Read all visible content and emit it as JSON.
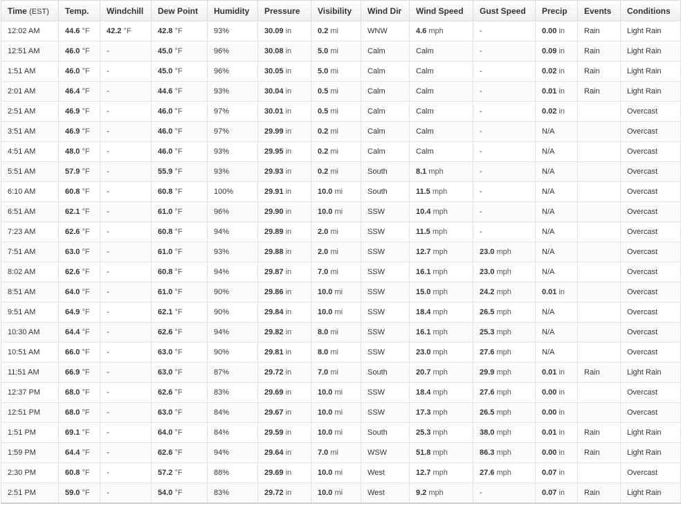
{
  "headers": {
    "time": "Time",
    "time_unit": "(EST)",
    "temp": "Temp.",
    "windchill": "Windchill",
    "dewpoint": "Dew Point",
    "humidity": "Humidity",
    "pressure": "Pressure",
    "visibility": "Visibility",
    "wind_dir": "Wind Dir",
    "wind_speed": "Wind Speed",
    "gust_speed": "Gust Speed",
    "precip": "Precip",
    "events": "Events",
    "conditions": "Conditions"
  },
  "units": {
    "temp": "°F",
    "pressure": "in",
    "visibility": "mi",
    "speed": "mph",
    "precip": "in"
  },
  "placeholders": {
    "dash": "-",
    "calm": "Calm",
    "na": "N/A"
  },
  "rows": [
    {
      "time": "12:02 AM",
      "temp": "44.6",
      "windchill": "42.2",
      "dewpoint": "42.8",
      "humidity": "93%",
      "pressure": "30.09",
      "visibility": "0.2",
      "wind_dir": "WNW",
      "wind_speed": "4.6",
      "gust": "-",
      "precip": "0.00",
      "events": "Rain",
      "conditions": "Light Rain"
    },
    {
      "time": "12:51 AM",
      "temp": "46.0",
      "windchill": "-",
      "dewpoint": "45.0",
      "humidity": "96%",
      "pressure": "30.08",
      "visibility": "5.0",
      "wind_dir": "Calm",
      "wind_speed": "Calm",
      "gust": "-",
      "precip": "0.09",
      "events": "Rain",
      "conditions": "Light Rain"
    },
    {
      "time": "1:51 AM",
      "temp": "46.0",
      "windchill": "-",
      "dewpoint": "45.0",
      "humidity": "96%",
      "pressure": "30.05",
      "visibility": "5.0",
      "wind_dir": "Calm",
      "wind_speed": "Calm",
      "gust": "-",
      "precip": "0.02",
      "events": "Rain",
      "conditions": "Light Rain"
    },
    {
      "time": "2:01 AM",
      "temp": "46.4",
      "windchill": "-",
      "dewpoint": "44.6",
      "humidity": "93%",
      "pressure": "30.04",
      "visibility": "0.5",
      "wind_dir": "Calm",
      "wind_speed": "Calm",
      "gust": "-",
      "precip": "0.01",
      "events": "Rain",
      "conditions": "Light Rain"
    },
    {
      "time": "2:51 AM",
      "temp": "46.9",
      "windchill": "-",
      "dewpoint": "46.0",
      "humidity": "97%",
      "pressure": "30.01",
      "visibility": "0.5",
      "wind_dir": "Calm",
      "wind_speed": "Calm",
      "gust": "-",
      "precip": "0.02",
      "events": "",
      "conditions": "Overcast"
    },
    {
      "time": "3:51 AM",
      "temp": "46.9",
      "windchill": "-",
      "dewpoint": "46.0",
      "humidity": "97%",
      "pressure": "29.99",
      "visibility": "0.2",
      "wind_dir": "Calm",
      "wind_speed": "Calm",
      "gust": "-",
      "precip": "N/A",
      "events": "",
      "conditions": "Overcast"
    },
    {
      "time": "4:51 AM",
      "temp": "48.0",
      "windchill": "-",
      "dewpoint": "46.0",
      "humidity": "93%",
      "pressure": "29.95",
      "visibility": "0.2",
      "wind_dir": "Calm",
      "wind_speed": "Calm",
      "gust": "-",
      "precip": "N/A",
      "events": "",
      "conditions": "Overcast"
    },
    {
      "time": "5:51 AM",
      "temp": "57.9",
      "windchill": "-",
      "dewpoint": "55.9",
      "humidity": "93%",
      "pressure": "29.93",
      "visibility": "0.2",
      "wind_dir": "South",
      "wind_speed": "8.1",
      "gust": "-",
      "precip": "N/A",
      "events": "",
      "conditions": "Overcast"
    },
    {
      "time": "6:10 AM",
      "temp": "60.8",
      "windchill": "-",
      "dewpoint": "60.8",
      "humidity": "100%",
      "pressure": "29.91",
      "visibility": "10.0",
      "wind_dir": "South",
      "wind_speed": "11.5",
      "gust": "-",
      "precip": "N/A",
      "events": "",
      "conditions": "Overcast"
    },
    {
      "time": "6:51 AM",
      "temp": "62.1",
      "windchill": "-",
      "dewpoint": "61.0",
      "humidity": "96%",
      "pressure": "29.90",
      "visibility": "10.0",
      "wind_dir": "SSW",
      "wind_speed": "10.4",
      "gust": "-",
      "precip": "N/A",
      "events": "",
      "conditions": "Overcast"
    },
    {
      "time": "7:23 AM",
      "temp": "62.6",
      "windchill": "-",
      "dewpoint": "60.8",
      "humidity": "94%",
      "pressure": "29.89",
      "visibility": "2.0",
      "wind_dir": "SSW",
      "wind_speed": "11.5",
      "gust": "-",
      "precip": "N/A",
      "events": "",
      "conditions": "Overcast"
    },
    {
      "time": "7:51 AM",
      "temp": "63.0",
      "windchill": "-",
      "dewpoint": "61.0",
      "humidity": "93%",
      "pressure": "29.88",
      "visibility": "2.0",
      "wind_dir": "SSW",
      "wind_speed": "12.7",
      "gust": "23.0",
      "precip": "N/A",
      "events": "",
      "conditions": "Overcast"
    },
    {
      "time": "8:02 AM",
      "temp": "62.6",
      "windchill": "-",
      "dewpoint": "60.8",
      "humidity": "94%",
      "pressure": "29.87",
      "visibility": "7.0",
      "wind_dir": "SSW",
      "wind_speed": "16.1",
      "gust": "23.0",
      "precip": "N/A",
      "events": "",
      "conditions": "Overcast"
    },
    {
      "time": "8:51 AM",
      "temp": "64.0",
      "windchill": "-",
      "dewpoint": "61.0",
      "humidity": "90%",
      "pressure": "29.86",
      "visibility": "10.0",
      "wind_dir": "SSW",
      "wind_speed": "15.0",
      "gust": "24.2",
      "precip": "0.01",
      "events": "",
      "conditions": "Overcast"
    },
    {
      "time": "9:51 AM",
      "temp": "64.9",
      "windchill": "-",
      "dewpoint": "62.1",
      "humidity": "90%",
      "pressure": "29.84",
      "visibility": "10.0",
      "wind_dir": "SSW",
      "wind_speed": "18.4",
      "gust": "26.5",
      "precip": "N/A",
      "events": "",
      "conditions": "Overcast"
    },
    {
      "time": "10:30 AM",
      "temp": "64.4",
      "windchill": "-",
      "dewpoint": "62.6",
      "humidity": "94%",
      "pressure": "29.82",
      "visibility": "8.0",
      "wind_dir": "SSW",
      "wind_speed": "16.1",
      "gust": "25.3",
      "precip": "N/A",
      "events": "",
      "conditions": "Overcast"
    },
    {
      "time": "10:51 AM",
      "temp": "66.0",
      "windchill": "-",
      "dewpoint": "63.0",
      "humidity": "90%",
      "pressure": "29.81",
      "visibility": "8.0",
      "wind_dir": "SSW",
      "wind_speed": "23.0",
      "gust": "27.6",
      "precip": "N/A",
      "events": "",
      "conditions": "Overcast"
    },
    {
      "time": "11:51 AM",
      "temp": "66.9",
      "windchill": "-",
      "dewpoint": "63.0",
      "humidity": "87%",
      "pressure": "29.72",
      "visibility": "7.0",
      "wind_dir": "South",
      "wind_speed": "20.7",
      "gust": "29.9",
      "precip": "0.01",
      "events": "Rain",
      "conditions": "Light Rain"
    },
    {
      "time": "12:37 PM",
      "temp": "68.0",
      "windchill": "-",
      "dewpoint": "62.6",
      "humidity": "83%",
      "pressure": "29.69",
      "visibility": "10.0",
      "wind_dir": "SSW",
      "wind_speed": "18.4",
      "gust": "27.6",
      "precip": "0.00",
      "events": "",
      "conditions": "Overcast"
    },
    {
      "time": "12:51 PM",
      "temp": "68.0",
      "windchill": "-",
      "dewpoint": "63.0",
      "humidity": "84%",
      "pressure": "29.67",
      "visibility": "10.0",
      "wind_dir": "SSW",
      "wind_speed": "17.3",
      "gust": "26.5",
      "precip": "0.00",
      "events": "",
      "conditions": "Overcast"
    },
    {
      "time": "1:51 PM",
      "temp": "69.1",
      "windchill": "-",
      "dewpoint": "64.0",
      "humidity": "84%",
      "pressure": "29.59",
      "visibility": "10.0",
      "wind_dir": "South",
      "wind_speed": "25.3",
      "gust": "38.0",
      "precip": "0.01",
      "events": "Rain",
      "conditions": "Light Rain"
    },
    {
      "time": "1:59 PM",
      "temp": "64.4",
      "windchill": "-",
      "dewpoint": "62.6",
      "humidity": "94%",
      "pressure": "29.64",
      "visibility": "7.0",
      "wind_dir": "WSW",
      "wind_speed": "51.8",
      "gust": "86.3",
      "precip": "0.00",
      "events": "Rain",
      "conditions": "Light Rain"
    },
    {
      "time": "2:30 PM",
      "temp": "60.8",
      "windchill": "-",
      "dewpoint": "57.2",
      "humidity": "88%",
      "pressure": "29.69",
      "visibility": "10.0",
      "wind_dir": "West",
      "wind_speed": "12.7",
      "gust": "27.6",
      "precip": "0.07",
      "events": "",
      "conditions": "Overcast"
    },
    {
      "time": "2:51 PM",
      "temp": "59.0",
      "windchill": "-",
      "dewpoint": "54.0",
      "humidity": "83%",
      "pressure": "29.72",
      "visibility": "10.0",
      "wind_dir": "West",
      "wind_speed": "9.2",
      "gust": "-",
      "precip": "0.07",
      "events": "Rain",
      "conditions": "Light Rain"
    }
  ]
}
